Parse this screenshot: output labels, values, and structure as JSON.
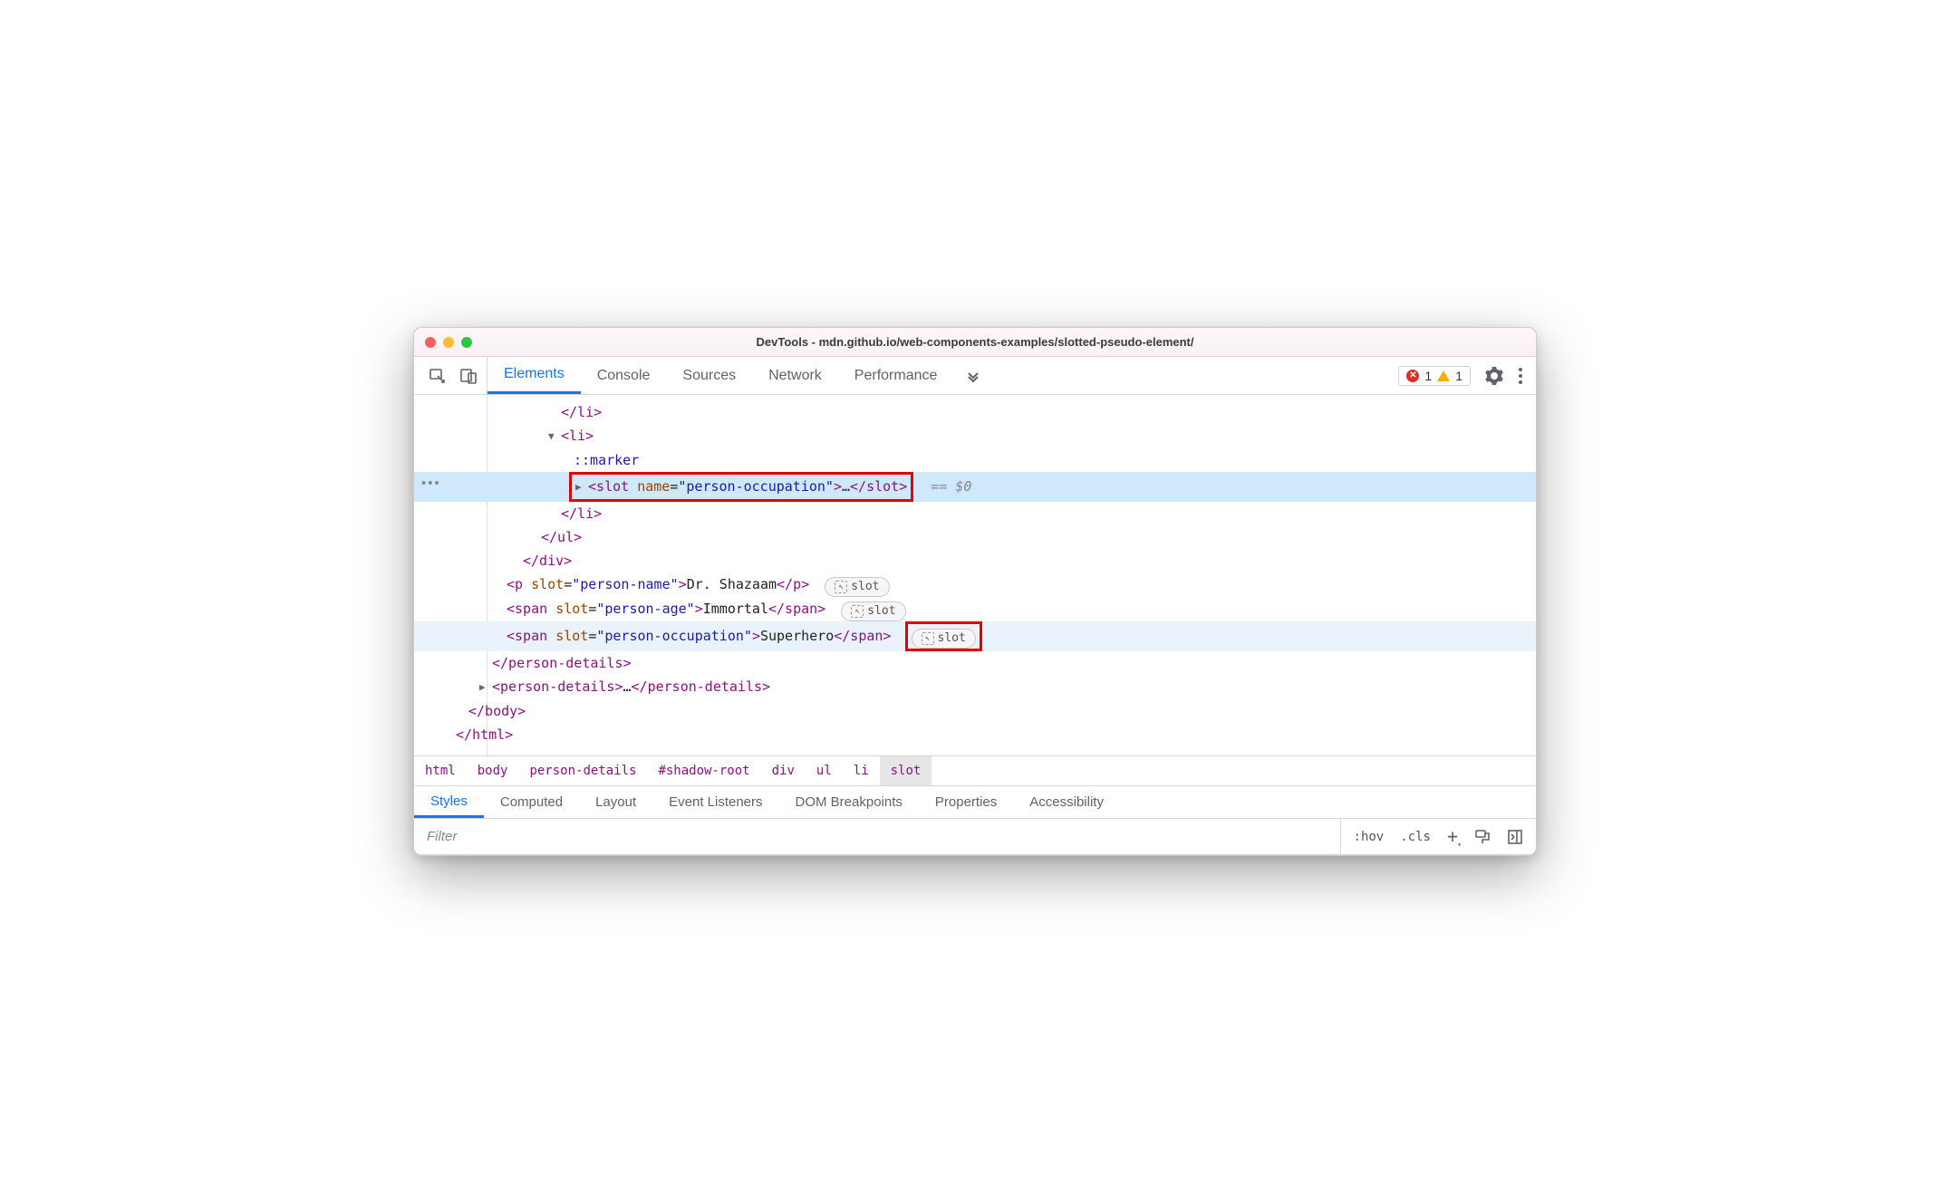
{
  "window": {
    "title": "DevTools - mdn.github.io/web-components-examples/slotted-pseudo-element/"
  },
  "toolbar": {
    "tabs": [
      "Elements",
      "Console",
      "Sources",
      "Network",
      "Performance"
    ],
    "errors": "1",
    "warnings": "1"
  },
  "tree": {
    "li_close1": "</li>",
    "li_open": "<li>",
    "marker": "::marker",
    "slot_open": "<slot ",
    "slot_attrname": "name",
    "slot_eq": "=",
    "slot_attrval": "\"person-occupation\"",
    "slot_openend": ">",
    "slot_ellipsis": "…",
    "slot_close": "</slot>",
    "slot_suffix": "== $0",
    "li_close2": "</li>",
    "ul_close": "</ul>",
    "div_close": "</div>",
    "p_open": "<p ",
    "p_attrname": "slot",
    "p_attrval": "\"person-name\"",
    "p_text": "Dr. Shazaam",
    "p_close": "</p>",
    "span1_open": "<span ",
    "span1_attrname": "slot",
    "span1_attrval": "\"person-age\"",
    "span1_text": "Immortal",
    "span1_close": "</span>",
    "span2_open": "<span ",
    "span2_attrname": "slot",
    "span2_attrval": "\"person-occupation\"",
    "span2_text": "Superhero",
    "span2_close": "</span>",
    "slot_pill": "slot",
    "pd_close": "</person-details>",
    "pd_open2": "<person-details>",
    "pd_ell": "…",
    "pd_close2": "</person-details>",
    "body_close": "</body>",
    "html_close": "</html>"
  },
  "crumbs": [
    "html",
    "body",
    "person-details",
    "#shadow-root",
    "div",
    "ul",
    "li",
    "slot"
  ],
  "lowertabs": [
    "Styles",
    "Computed",
    "Layout",
    "Event Listeners",
    "DOM Breakpoints",
    "Properties",
    "Accessibility"
  ],
  "filter": {
    "placeholder": "Filter",
    "hov": ":hov",
    "cls": ".cls"
  }
}
